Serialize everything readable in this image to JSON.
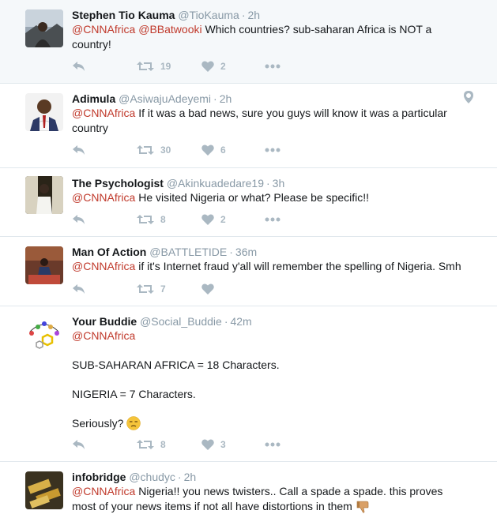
{
  "tweets": [
    {
      "name": "Stephen Tio Kauma",
      "handle": "@TioKauma",
      "time": "2h",
      "mentions": [
        "@CNNAfrica",
        "@BBatwooki"
      ],
      "text": "Which countries? sub-saharan Africa is NOT a country!",
      "retweets": "19",
      "likes": "2"
    },
    {
      "name": "Adimula",
      "handle": "@AsiwajuAdeyemi",
      "time": "2h",
      "mentions": [
        "@CNNAfrica"
      ],
      "text": "If it was a bad news, sure you guys will know it was a particular country",
      "retweets": "30",
      "likes": "6"
    },
    {
      "name": "The Psychologist",
      "handle": "@Akinkuadedare19",
      "time": "3h",
      "mentions": [
        "@CNNAfrica"
      ],
      "text": "He visited Nigeria or what? Please be specific!!",
      "retweets": "8",
      "likes": "2"
    },
    {
      "name": "Man Of Action",
      "handle": "@BATTLETIDE",
      "time": "36m",
      "mentions": [
        "@CNNAfrica"
      ],
      "text": "if it's Internet fraud y'all will remember the spelling of Nigeria. Smh",
      "retweets": "7",
      "likes": ""
    },
    {
      "name": "Your Buddie",
      "handle": "@Social_Buddie",
      "time": "42m",
      "mentions": [
        "@CNNAfrica"
      ],
      "lines": [
        "SUB-SAHARAN AFRICA = 18 Characters.",
        "NIGERIA = 7 Characters.",
        "Seriously?"
      ],
      "retweets": "8",
      "likes": "3"
    },
    {
      "name": "infobridge",
      "handle": "@chudyc",
      "time": "2h",
      "mentions": [
        "@CNNAfrica"
      ],
      "text": "Nigeria!! you news twisters.. Call a spade a spade. this proves most of your news items if not all have distortions in them"
    }
  ],
  "icons": {
    "reply": "reply-icon",
    "retweet": "retweet-icon",
    "like": "heart-icon",
    "more": "more-icon",
    "location": "location-pin-icon",
    "emoji_sad": "unamused-face-emoji",
    "emoji_thumbs": "thumbs-down-emoji"
  },
  "colors": {
    "mention": "#c0392b",
    "muted": "#8899a6",
    "action": "#aab8c2",
    "highlight_bg": "#f5f8fa"
  }
}
